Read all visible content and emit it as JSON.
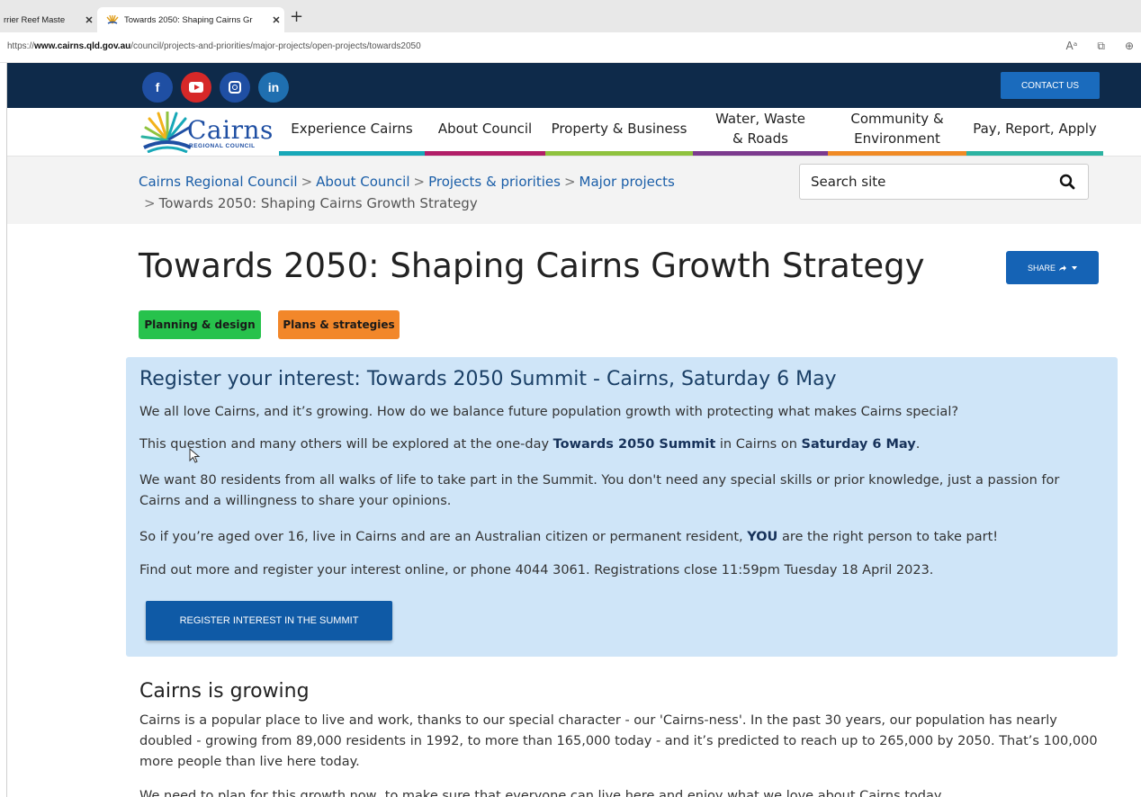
{
  "browser": {
    "tabs": [
      {
        "title": "rrier Reef Maste",
        "active": false
      },
      {
        "title": "Towards 2050: Shaping Cairns Gr",
        "active": true
      }
    ],
    "new_tab": "+",
    "close": "✕",
    "url_prefix": "https://",
    "url_domain": "www.cairns.qld.gov.au",
    "url_path": "/council/projects-and-priorities/major-projects/open-projects/towards2050",
    "address_icons": [
      "Aᵃ",
      "⧉",
      "⊕"
    ]
  },
  "topbar": {
    "social": [
      {
        "name": "facebook",
        "glyph": "f"
      },
      {
        "name": "youtube",
        "glyph": ""
      },
      {
        "name": "instagram",
        "glyph": ""
      },
      {
        "name": "linkedin",
        "glyph": "in"
      }
    ],
    "contact_label": "CONTACT US"
  },
  "logo": {
    "word": "Cairns",
    "sub": "REGIONAL COUNCIL"
  },
  "nav": {
    "items": [
      {
        "label": "Experience Cairns",
        "color": "#17a8b8"
      },
      {
        "label": "About Council",
        "color": "#b21e68"
      },
      {
        "label": "Property & Business",
        "color": "#8fc23e"
      },
      {
        "label": "Water, Waste & Roads",
        "color": "#7c3a8e"
      },
      {
        "label": "Community & Environment",
        "color": "#f08a24"
      },
      {
        "label": "Pay, Report, Apply",
        "color": "#2cb3a2"
      }
    ]
  },
  "breadcrumb": {
    "items": [
      "Cairns Regional Council",
      "About Council",
      "Projects & priorities",
      "Major projects"
    ],
    "current": "Towards 2050: Shaping Cairns Growth Strategy",
    "separator": ">"
  },
  "search": {
    "placeholder": "Search site"
  },
  "page": {
    "title": "Towards 2050: Shaping Cairns Growth Strategy",
    "share_label": "SHARE",
    "tags": [
      {
        "label": "Planning & design",
        "color": "#27c24c"
      },
      {
        "label": "Plans & strategies",
        "color": "#f2872a"
      }
    ]
  },
  "panel": {
    "heading": "Register your interest: Towards 2050 Summit - Cairns, Saturday 6 May",
    "p1": "We all love Cairns, and it’s growing.  How do we balance future population growth with protecting what makes Cairns special?",
    "p2_before": "This question and many others will be explored at the one-day ",
    "p2_bold1": "Towards 2050 Summit",
    "p2_middle": " in Cairns on ",
    "p2_bold2": "Saturday 6 May",
    "p2_after": ".",
    "p3": "We want 80 residents from all walks of life to take part in the Summit.  You don't need any special skills or prior knowledge, just a passion for Cairns and a willingness to share your opinions.",
    "p4_before": "So if you’re aged over 16, live in Cairns and are an Australian citizen or permanent resident, ",
    "p4_bold": "YOU",
    "p4_after": " are the right person to take part!",
    "p5": "Find out more and register your interest online, or phone 4044 3061.  Registrations close 11:59pm Tuesday 18 April 2023.",
    "button_label": "REGISTER INTEREST IN THE SUMMIT",
    "bg_color": "#cfe5f8"
  },
  "growing": {
    "heading": "Cairns is growing",
    "p1": "Cairns is a popular place to live and work, thanks to our special character - our 'Cairns-ness'.  In the past 30 years, our population has nearly doubled - growing from 89,000 residents in 1992, to more than 165,000 today - and it’s predicted to reach up to 265,000 by 2050. That’s 100,000 more people than live here today.",
    "p2": "We need to plan for this growth now, to make sure that everyone can live here and enjoy what we love about Cairns today."
  },
  "colors": {
    "topbar": "#0e2a4a",
    "accent_blue": "#1563b5",
    "link": "#1a5ea8"
  }
}
